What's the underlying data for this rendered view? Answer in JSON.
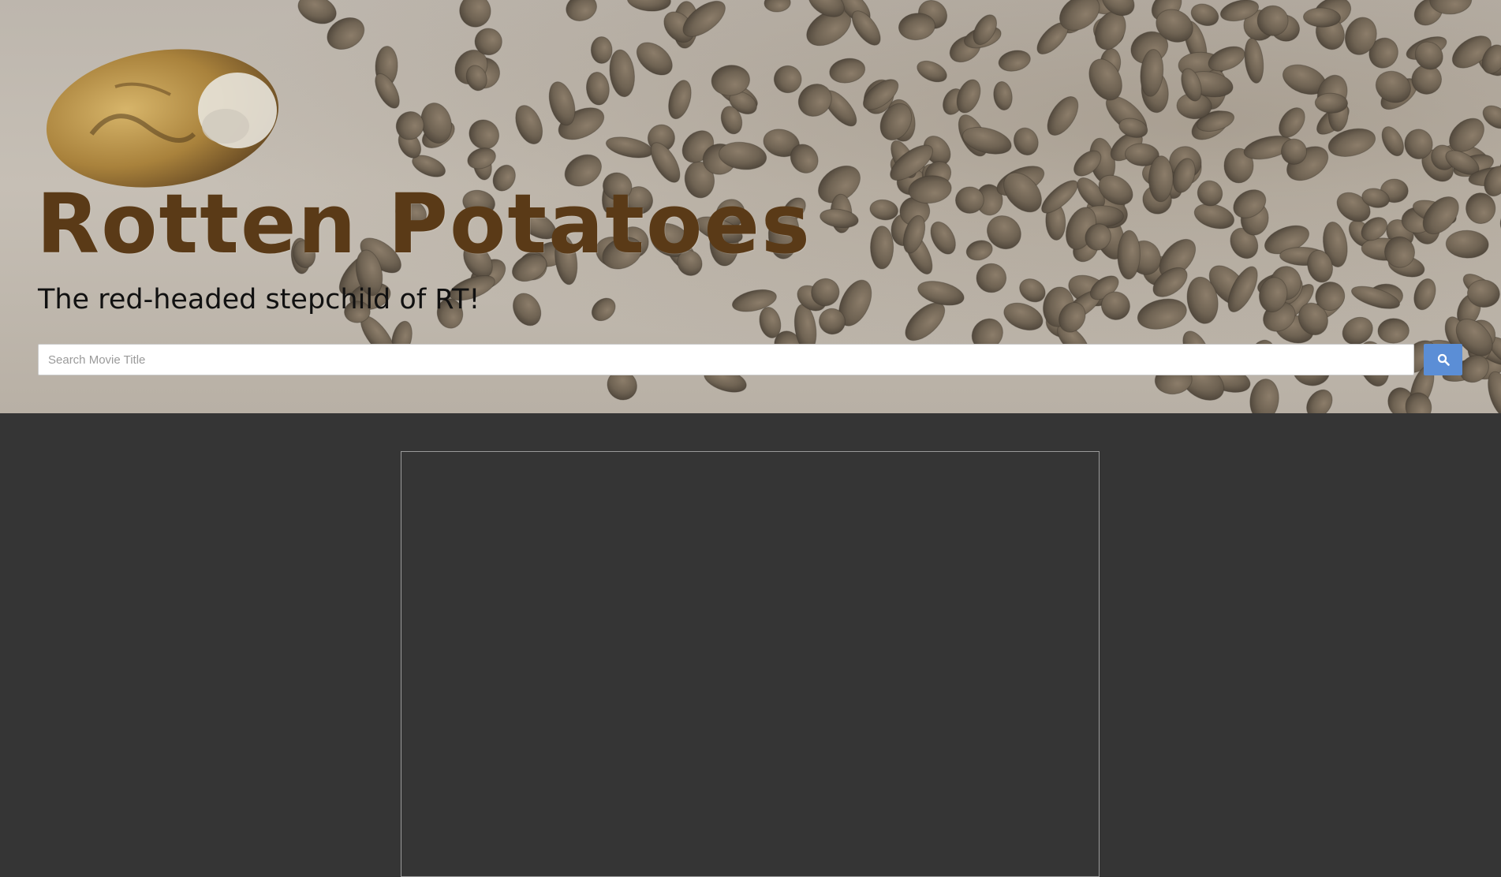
{
  "header": {
    "title": "Rotten Potatoes",
    "tagline": "The red-headed stepchild of RT!"
  },
  "search": {
    "placeholder": "Search Movie Title",
    "value": "",
    "button_icon": "search-icon"
  },
  "colors": {
    "page_background": "#353535",
    "title_color": "#5a3a17",
    "search_button": "#5b8ed6"
  }
}
